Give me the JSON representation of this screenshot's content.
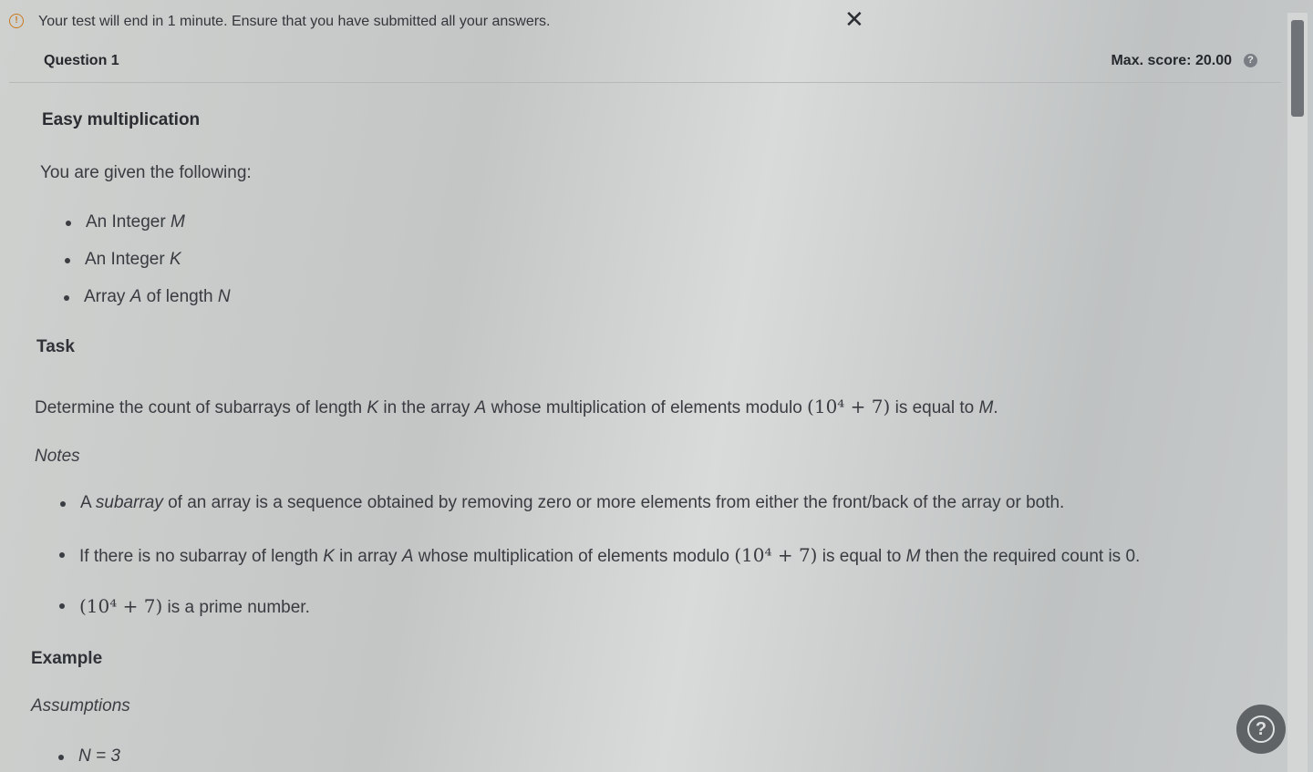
{
  "alert": {
    "icon": "info-circle-icon",
    "text": "Your test will end in 1 minute. Ensure that you have submitted all your answers.",
    "close_icon": "close-icon",
    "close_glyph": "✕"
  },
  "question": {
    "label": "Question  1",
    "max_score": "Max. score: 20.00",
    "help_glyph": "?"
  },
  "problem": {
    "title": "Easy multiplication",
    "intro": "You are given the following:",
    "givens": [
      {
        "pre": "An Integer ",
        "var": "M"
      },
      {
        "pre": "An Integer ",
        "var": "K"
      },
      {
        "pre": "Array ",
        "var": "A",
        "mid": " of length ",
        "var2": "N"
      }
    ],
    "task_heading": "Task",
    "task_text": {
      "a": "Determine the count of subarrays of length ",
      "k": "K",
      "b": " in the array ",
      "arr": "A",
      "c": " whose multiplication of elements modulo ",
      "expr": "(10⁴ + 7)",
      "d": " is equal to ",
      "m": "M",
      "e": "."
    },
    "notes_heading": "Notes",
    "notes": [
      {
        "pre": "A ",
        "em": "subarray",
        "post": " of an array is a sequence obtained by removing zero or more elements from either the front/back of the array or both."
      },
      {
        "a": "If there is no subarray of length ",
        "k": "K",
        "b": " in array ",
        "arr": "A",
        "c": " whose multiplication of elements modulo ",
        "expr": "(10⁴ + 7)",
        "d": " is equal to ",
        "m": "M",
        "e": " then the required count is 0."
      },
      {
        "expr": "(10⁴ + 7)",
        "post": " is a prime number."
      }
    ],
    "example_heading": "Example",
    "assumptions_heading": "Assumptions",
    "assumptions": [
      {
        "text": "N = 3"
      }
    ]
  },
  "help_button": {
    "icon": "help-circle-icon",
    "glyph": "?"
  }
}
